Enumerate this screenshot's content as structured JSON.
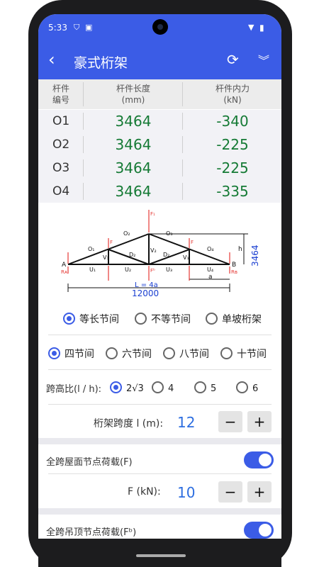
{
  "status": {
    "time": "5:33",
    "icons": [
      "shield-icon",
      "a-box-icon",
      "wifi-icon",
      "battery-icon"
    ]
  },
  "appbar": {
    "title": "豪式桁架",
    "back_icon": "back-arrow-icon",
    "refresh_icon": "refresh-icon",
    "more_icon": "chevron-double-down-icon"
  },
  "table": {
    "headers": [
      {
        "line1": "杆件",
        "line2": "编号"
      },
      {
        "line1": "杆件长度",
        "line2": "(mm)"
      },
      {
        "line1": "杆件内力",
        "line2": "(kN)"
      }
    ],
    "rows": [
      {
        "id": "O1",
        "length": "3464",
        "force": "-340"
      },
      {
        "id": "O2",
        "length": "3464",
        "force": "-225"
      },
      {
        "id": "O3",
        "length": "3464",
        "force": "-225"
      },
      {
        "id": "O4",
        "length": "3464",
        "force": "-335"
      }
    ]
  },
  "diagram": {
    "top_labels": [
      "O₁",
      "O₂",
      "O₃",
      "O₄"
    ],
    "bottom_labels": [
      "U₁",
      "U₂",
      "U₃",
      "U₄"
    ],
    "diagonals": [
      "D₁",
      "D₂",
      "D₂",
      "D₁"
    ],
    "verticals": [
      "V₁",
      "V₂",
      "V₁"
    ],
    "node_a": "A",
    "node_b": "B",
    "span_formula": "L = 4a",
    "span_value": "12000",
    "height_value": "3464",
    "h_label": "h",
    "a_label": "a",
    "load_F": "F",
    "load_F1": "F₁",
    "load_Fb": "Fᵇ",
    "RA": "Rᴀ",
    "RB": "Rʙ"
  },
  "spacing_options": {
    "options": [
      "等长节间",
      "不等节间",
      "单坡桁架"
    ],
    "selected": "等长节间"
  },
  "panel_options": {
    "options": [
      "四节间",
      "六节间",
      "八节间",
      "十节间"
    ],
    "selected": "四节间"
  },
  "ratio": {
    "label": "跨高比(l / h):",
    "options": [
      "2√3",
      "4",
      "5",
      "6"
    ],
    "selected": "2√3"
  },
  "span": {
    "label": "桁架跨度 l (m):",
    "value": "12",
    "minus": "−",
    "plus": "+"
  },
  "roof_load": {
    "label": "全跨屋面节点荷载(F)",
    "on": true
  },
  "force_F": {
    "label": "F (kN):",
    "value": "10",
    "minus": "−",
    "plus": "+"
  },
  "ceiling_load": {
    "label": "全跨吊顶节点荷载(Fᵇ)",
    "on": true
  }
}
